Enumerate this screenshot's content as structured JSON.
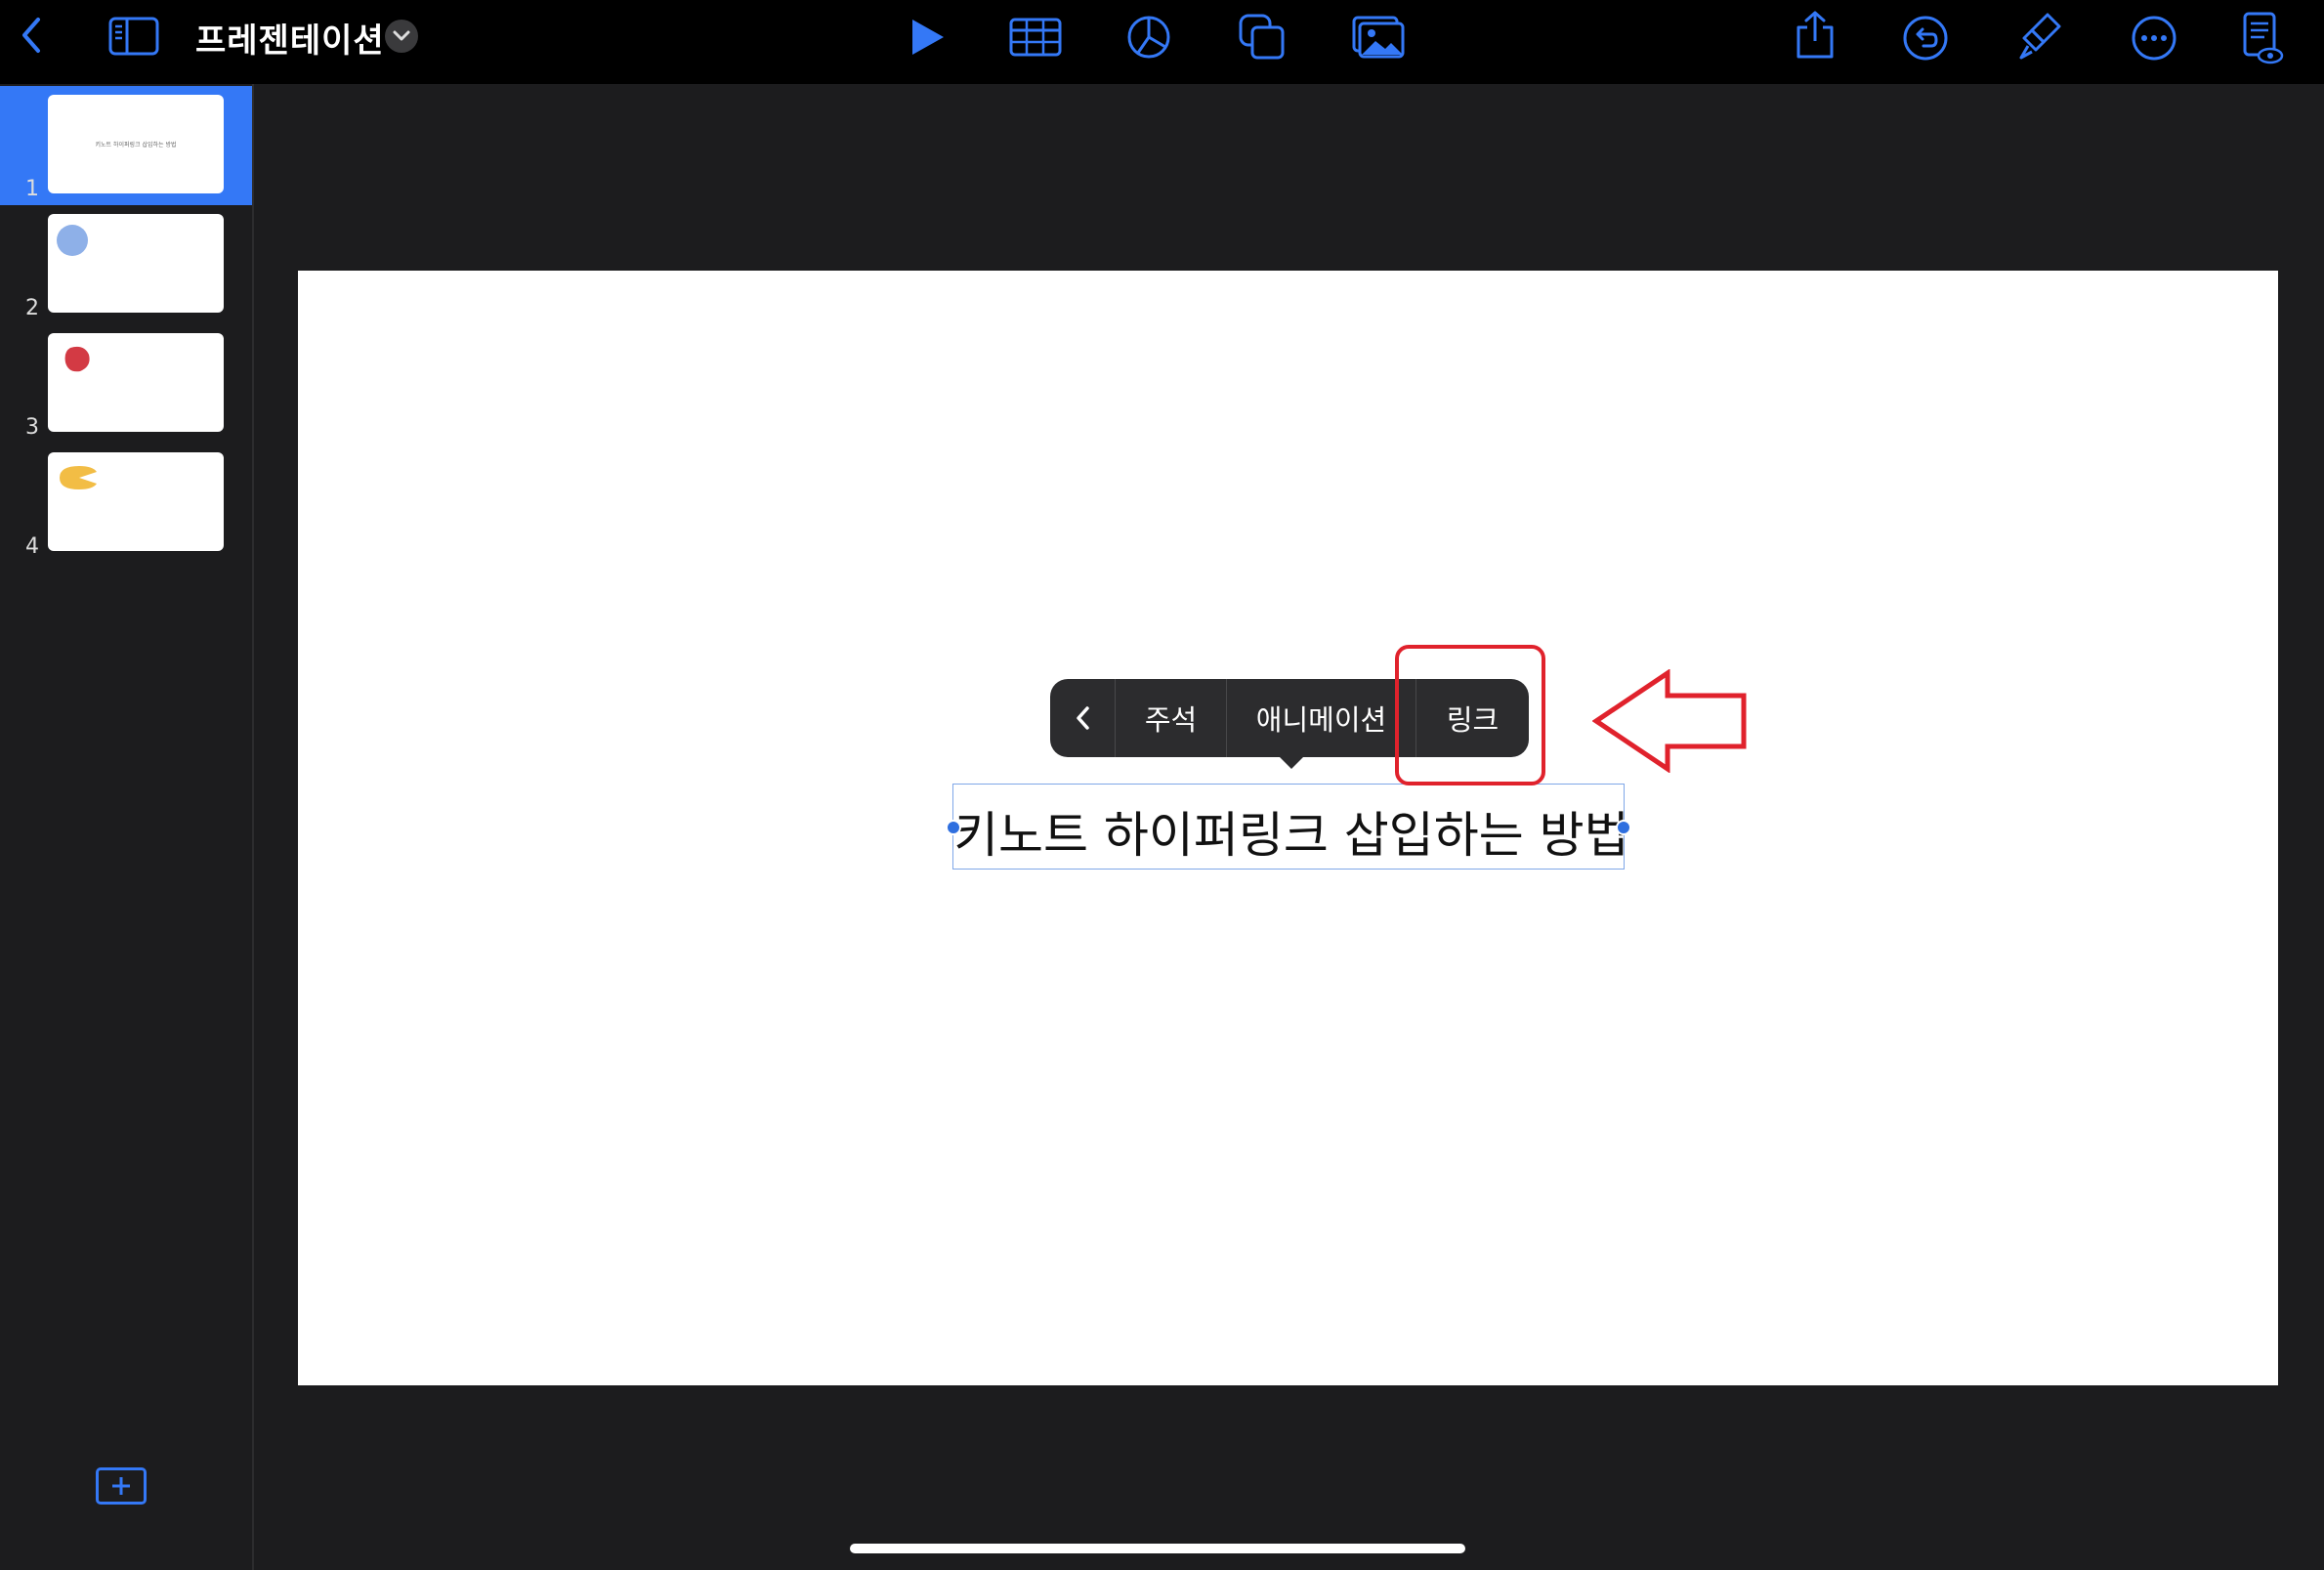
{
  "topbar": {
    "title": "프레젠테이션",
    "icons": [
      "back-icon",
      "sidebar-toggle-icon",
      "chevron-down-icon",
      "play-icon",
      "table-icon",
      "chart-icon",
      "shapes-icon",
      "media-icon",
      "share-icon",
      "undo-icon",
      "format-brush-icon",
      "more-icon",
      "presenter-notes-icon"
    ]
  },
  "sidebar": {
    "slides": [
      {
        "number": "1",
        "text": "키노트 하이퍼링크 삽입하는 방법",
        "selected": true
      },
      {
        "number": "2",
        "shape": "blue-circle",
        "color": "#8eb0e8"
      },
      {
        "number": "3",
        "shape": "red-blob",
        "color": "#d33a44"
      },
      {
        "number": "4",
        "shape": "yellow-pacman",
        "color": "#f2bd45"
      }
    ],
    "add_slide_icon": "add-slide-icon"
  },
  "slide": {
    "title_text": "키노트 하이퍼링크 삽입하는 방법"
  },
  "popup_menu": {
    "items": [
      "주석",
      "애니메이션",
      "링크"
    ],
    "back_icon": "chevron-left-icon"
  },
  "annotation": {
    "highlight_color": "#e0222c",
    "arrow_icon": "left-arrow-icon"
  },
  "colors": {
    "accent": "#3478f6",
    "background": "#000000",
    "panel": "#1c1c1e"
  }
}
